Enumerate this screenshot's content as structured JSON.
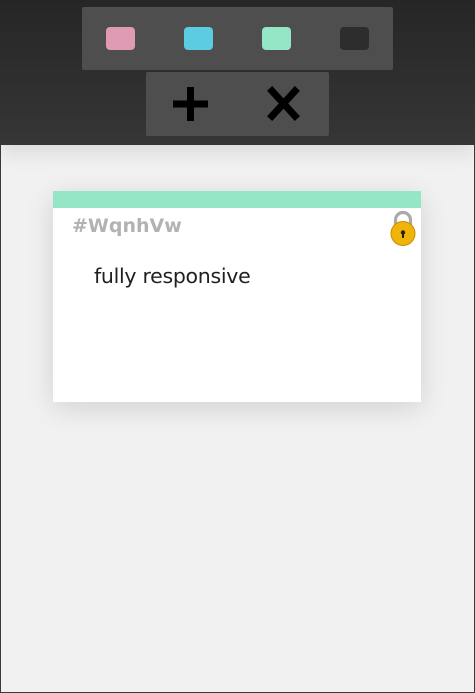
{
  "colors": {
    "page_background": "#f1f1f1",
    "header_background": "#2d2d2d",
    "toolbar_background": "#4e4e4e",
    "accent": "#94e6c6"
  },
  "color_palette": [
    {
      "name": "pink",
      "hex": "#e09bb4"
    },
    {
      "name": "blue",
      "hex": "#5ccce2"
    },
    {
      "name": "mint",
      "hex": "#94e6c6"
    },
    {
      "name": "dark",
      "hex": "#2d2d2d"
    }
  ],
  "actions": [
    {
      "name": "add",
      "icon": "plus-icon"
    },
    {
      "name": "close",
      "icon": "close-icon"
    }
  ],
  "note": {
    "id": "#WqnhVw",
    "text": "fully responsive",
    "color": "#94e6c6",
    "lock_icon": "lock-icon",
    "lock_color": "#f0b30a"
  }
}
